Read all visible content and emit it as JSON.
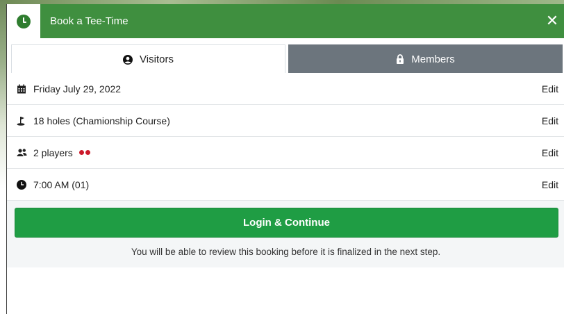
{
  "header": {
    "title": "Book a Tee-Time",
    "close_label": "✕",
    "color": "#3f8f3f"
  },
  "tabs": [
    {
      "label": "Visitors",
      "icon": "user-circle-icon",
      "active": true
    },
    {
      "label": "Members",
      "icon": "lock-icon",
      "active": false
    }
  ],
  "booking": {
    "rows": [
      {
        "icon": "calendar-icon",
        "label": "Friday July 29, 2022",
        "edit": "Edit"
      },
      {
        "icon": "golf-flag-icon",
        "label": "18 holes (Chamionship Course)",
        "edit": "Edit"
      },
      {
        "icon": "users-icon",
        "label": "2 players",
        "edit": "Edit",
        "player_dots": 2
      },
      {
        "icon": "clock-icon",
        "label": "7:00 AM (01)",
        "edit": "Edit"
      }
    ]
  },
  "footer": {
    "cta_label": "Login & Continue",
    "cta_color": "#1f9d44",
    "note": "You will be able to review this booking before it is finalized in the next step."
  }
}
